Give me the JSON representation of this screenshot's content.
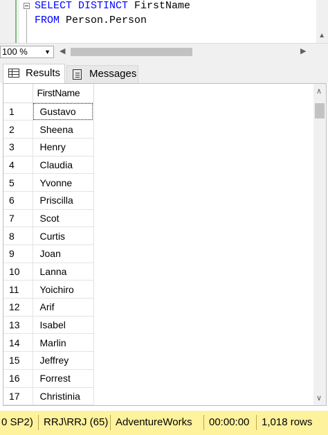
{
  "editor": {
    "line1_keyword": "SELECT DISTINCT",
    "line1_identifier": "FirstName",
    "line2_keyword": "FROM",
    "line2_identifier": "Person.Person"
  },
  "zoom": {
    "value": "100 %"
  },
  "tabs": [
    {
      "label": "Results",
      "icon": "grid-icon",
      "active": true
    },
    {
      "label": "Messages",
      "icon": "messages-icon",
      "active": false
    }
  ],
  "grid": {
    "column_header": "FirstName",
    "rows": [
      {
        "num": "1",
        "value": "Gustavo"
      },
      {
        "num": "2",
        "value": "Sheena"
      },
      {
        "num": "3",
        "value": "Henry"
      },
      {
        "num": "4",
        "value": "Claudia"
      },
      {
        "num": "5",
        "value": "Yvonne"
      },
      {
        "num": "6",
        "value": "Priscilla"
      },
      {
        "num": "7",
        "value": "Scot"
      },
      {
        "num": "8",
        "value": "Curtis"
      },
      {
        "num": "9",
        "value": "Joan"
      },
      {
        "num": "10",
        "value": "Lanna"
      },
      {
        "num": "11",
        "value": "Yoichiro"
      },
      {
        "num": "12",
        "value": "Arif"
      },
      {
        "num": "13",
        "value": "Isabel"
      },
      {
        "num": "14",
        "value": "Marlin"
      },
      {
        "num": "15",
        "value": "Jeffrey"
      },
      {
        "num": "16",
        "value": "Forrest"
      },
      {
        "num": "17",
        "value": "Christinia"
      }
    ]
  },
  "status": {
    "server_version": "0 SP2)",
    "user": "RRJ\\RRJ (65)",
    "database": "AdventureWorks",
    "elapsed": "00:00:00",
    "row_count": "1,018 rows",
    "color": "#fff29d"
  }
}
